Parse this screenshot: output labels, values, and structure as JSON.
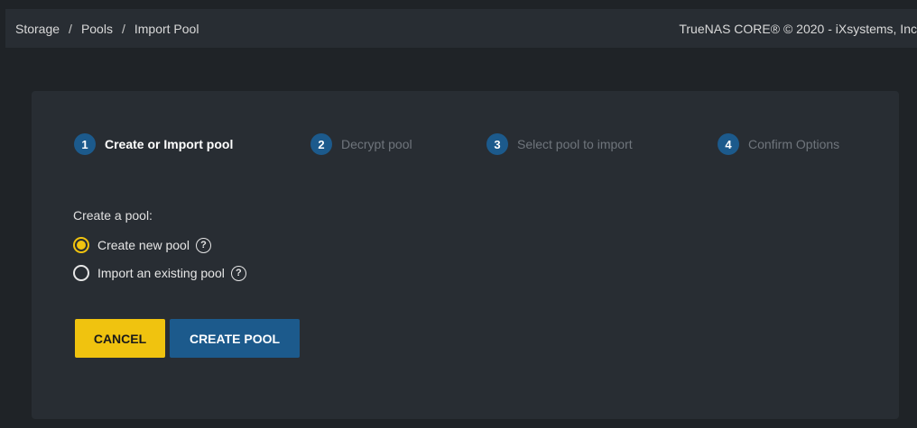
{
  "breadcrumb": {
    "items": [
      "Storage",
      "Pools",
      "Import Pool"
    ],
    "separator": "/"
  },
  "header": {
    "copyright": "TrueNAS CORE® © 2020 - iXsystems, Inc"
  },
  "stepper": {
    "steps": [
      {
        "number": "1",
        "label": "Create or Import pool",
        "state": "active"
      },
      {
        "number": "2",
        "label": "Decrypt pool",
        "state": "inactive"
      },
      {
        "number": "3",
        "label": "Select pool to import",
        "state": "inactive"
      },
      {
        "number": "4",
        "label": "Confirm Options",
        "state": "inactive"
      }
    ]
  },
  "form": {
    "title": "Create a pool:",
    "options": [
      {
        "label": "Create new pool",
        "selected": true,
        "help_icon": "?"
      },
      {
        "label": "Import an existing pool",
        "selected": false,
        "help_icon": "?"
      }
    ]
  },
  "actions": {
    "cancel_label": "CANCEL",
    "create_label": "CREATE POOL"
  },
  "colors": {
    "accent_yellow": "#f0c30f",
    "primary_blue": "#1c5a8c",
    "background": "#1f2327",
    "card": "#282d33"
  }
}
